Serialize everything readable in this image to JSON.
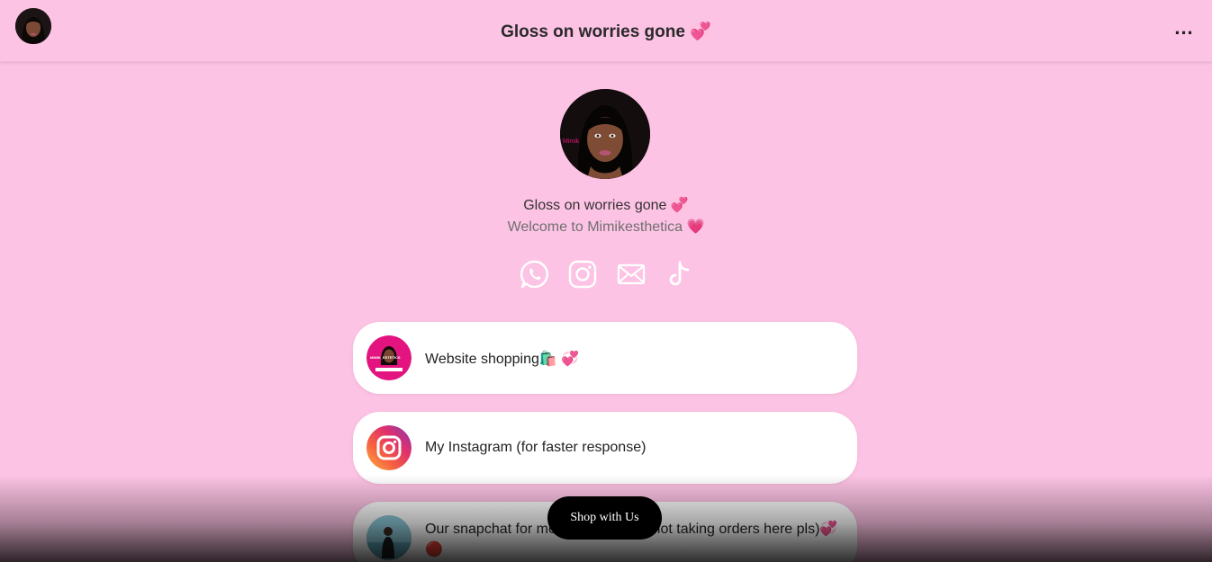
{
  "header": {
    "title": "Gloss on worries gone 💞",
    "more_label": "..."
  },
  "profile": {
    "name": "Gloss on worries gone 💞",
    "bio": "Welcome to Mimikesthetica 💗",
    "avatar_caption": "Mimik"
  },
  "socials": [
    {
      "icon": "whatsapp-icon"
    },
    {
      "icon": "instagram-icon"
    },
    {
      "icon": "email-icon"
    },
    {
      "icon": "tiktok-icon"
    }
  ],
  "links": [
    {
      "label": "Website shopping🛍️ 💞",
      "thumb_caption": "MIMIK_ESTETICS"
    },
    {
      "label": "My Instagram (for faster response)"
    },
    {
      "label": "Our snapchat for more info (we are not taking orders here pls)💞 🔴"
    }
  ],
  "cta": {
    "label": "Shop with Us"
  },
  "colors": {
    "background": "#fdc3e4",
    "card": "#ffffff",
    "cta_background": "#000000",
    "thumb_pink": "#e3137f"
  }
}
